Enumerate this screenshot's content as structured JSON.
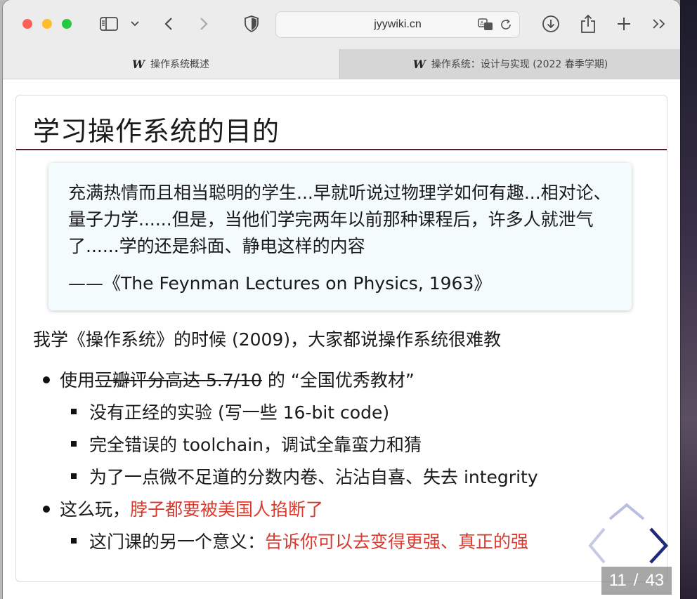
{
  "browser": {
    "url": "jyywiki.cn",
    "tabs": [
      {
        "logo": "W",
        "label": "操作系统概述"
      },
      {
        "logo": "W",
        "label": "操作系统：设计与实现 (2022 春季学期)"
      }
    ]
  },
  "slide": {
    "title": "学习操作系统的目的",
    "quote": {
      "text": "充满热情而且相当聪明的学生...早就听说过物理学如何有趣...相对论、量子力学......但是，当他们学完两年以前那种课程后，许多人就泄气了......学的还是斜面、静电这样的内容",
      "source": "——《The Feynman Lectures on Physics, 1963》"
    },
    "paragraph": "我学《操作系统》的时候 (2009)，大家都说操作系统很难教",
    "bullet1": {
      "prefix": "使用",
      "strike": "豆瓣评分高达 5.7/10",
      "suffix": " 的 “全国优秀教材”",
      "subs": [
        "没有正经的实验 (写一些 16-bit code)",
        "完全错误的 toolchain，调试全靠蛮力和猜",
        "为了一点微不足道的分数内卷、沾沾自喜、失去 integrity"
      ]
    },
    "bullet2": {
      "prefix": "这么玩，",
      "red": "脖子都要被美国人掐断了",
      "sub_prefix": "这门课的另一个意义：",
      "sub_red": "告诉你可以去变得更强、真正的强"
    }
  },
  "nav": {
    "current": "11",
    "separator": "/",
    "total": "43"
  },
  "icons": {
    "sidebar": "sidebar-icon",
    "chevron": "chevron-down-icon",
    "back": "back-arrow-icon",
    "forward": "forward-arrow-icon",
    "shield": "shield-icon",
    "translate": "translate-icon",
    "reload": "reload-icon",
    "download": "download-icon",
    "share": "share-icon",
    "newtab": "plus-icon",
    "more": "double-chevron-icon"
  },
  "colors": {
    "accent_red": "#d83a2e",
    "title_rule": "#5a1a3a",
    "nav_arrow": "#1f2a7a"
  }
}
